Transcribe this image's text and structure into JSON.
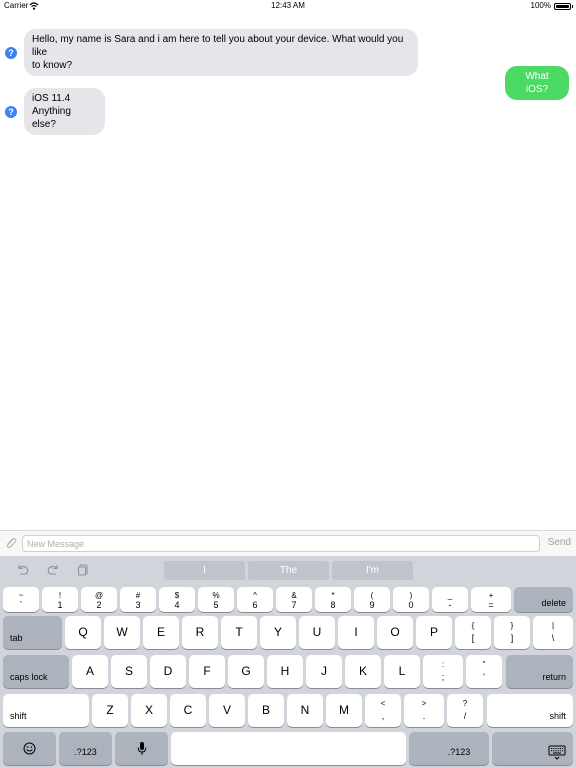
{
  "status_bar": {
    "carrier": "Carrier",
    "time": "12:43 AM",
    "battery": "100%"
  },
  "chat": {
    "messages": [
      {
        "from": "bot",
        "lines": [
          "Hello, my name is Sara and i am here to tell you about your device. What would you like",
          "to know?"
        ]
      },
      {
        "from": "user",
        "text": "What iOS?"
      },
      {
        "from": "bot",
        "lines": [
          "iOS 11.4",
          "Anything else?"
        ]
      }
    ],
    "avatar_glyph": "?"
  },
  "input_bar": {
    "placeholder": "New Message",
    "send_label": "Send"
  },
  "keyboard": {
    "suggestions": [
      "I",
      "The",
      "I'm"
    ],
    "number_row": [
      {
        "top": "~",
        "bot": "`"
      },
      {
        "top": "!",
        "bot": "1"
      },
      {
        "top": "@",
        "bot": "2"
      },
      {
        "top": "#",
        "bot": "3"
      },
      {
        "top": "$",
        "bot": "4"
      },
      {
        "top": "%",
        "bot": "5"
      },
      {
        "top": "^",
        "bot": "6"
      },
      {
        "top": "&",
        "bot": "7"
      },
      {
        "top": "*",
        "bot": "8"
      },
      {
        "top": "(",
        "bot": "9"
      },
      {
        "top": ")",
        "bot": "0"
      },
      {
        "top": "_",
        "bot": "-"
      },
      {
        "top": "+",
        "bot": "="
      }
    ],
    "delete_label": "delete",
    "tab_label": "tab",
    "row_q": [
      "Q",
      "W",
      "E",
      "R",
      "T",
      "Y",
      "U",
      "I",
      "O",
      "P"
    ],
    "row_q_punct": [
      {
        "top": "{",
        "bot": "["
      },
      {
        "top": "}",
        "bot": "]"
      },
      {
        "top": "|",
        "bot": "\\"
      }
    ],
    "caps_label": "caps lock",
    "row_a": [
      "A",
      "S",
      "D",
      "F",
      "G",
      "H",
      "J",
      "K",
      "L"
    ],
    "row_a_punct": [
      {
        "top": ":",
        "bot": ";"
      },
      {
        "top": "\"",
        "bot": "'"
      }
    ],
    "return_label": "return",
    "shift_label": "shift",
    "row_z": [
      "Z",
      "X",
      "C",
      "V",
      "B",
      "N",
      "M"
    ],
    "row_z_punct": [
      {
        "top": "<",
        "bot": ","
      },
      {
        "top": ">",
        "bot": "."
      },
      {
        "top": "?",
        "bot": "/"
      }
    ],
    "numbers_label": ".?123"
  }
}
